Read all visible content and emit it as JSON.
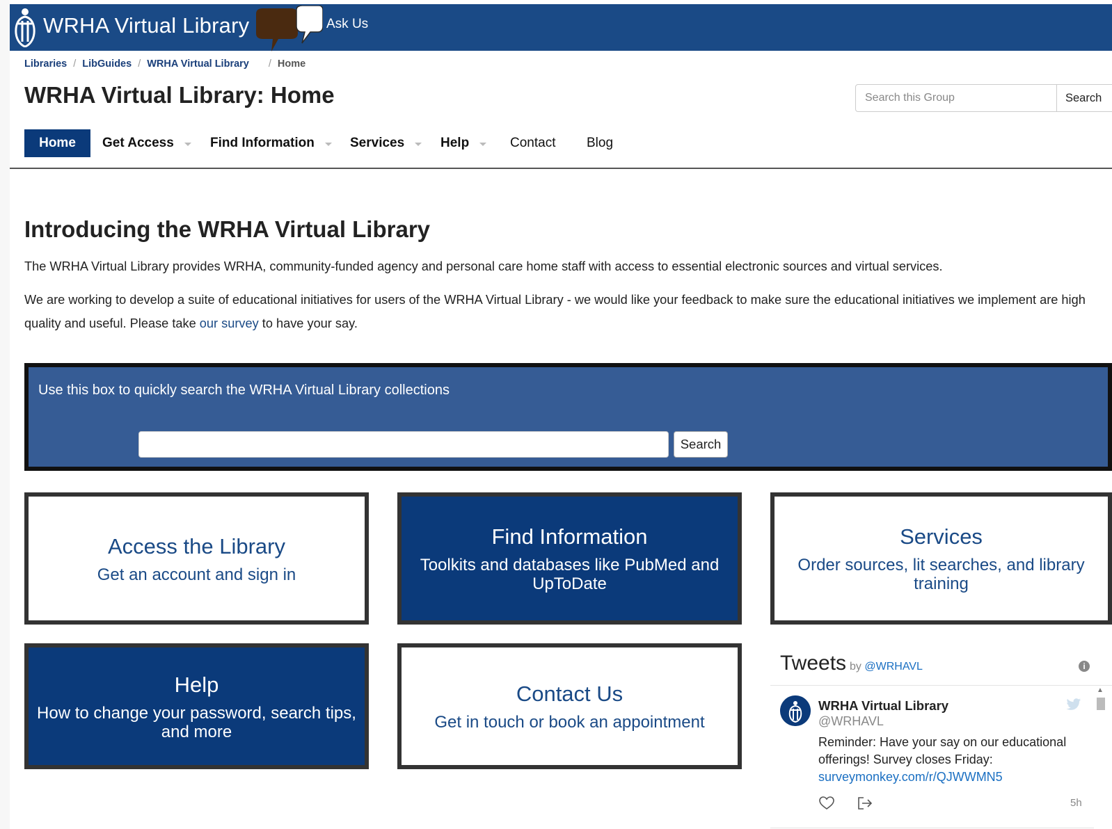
{
  "header": {
    "brand": "WRHA Virtual Library",
    "ask_us": "Ask Us"
  },
  "breadcrumb": {
    "items": [
      "Libraries",
      "LibGuides",
      "WRHA Virtual Library",
      "Home"
    ],
    "separator": "/"
  },
  "page_title": "WRHA Virtual Library: Home",
  "group_search": {
    "placeholder": "Search this Group",
    "button": "Search"
  },
  "nav": {
    "items": [
      {
        "label": "Home",
        "active": true,
        "has_dropdown": false
      },
      {
        "label": "Get Access",
        "active": false,
        "has_dropdown": true
      },
      {
        "label": "Find Information",
        "active": false,
        "has_dropdown": true
      },
      {
        "label": "Services",
        "active": false,
        "has_dropdown": true
      },
      {
        "label": "Help",
        "active": false,
        "has_dropdown": true
      },
      {
        "label": "Contact",
        "active": false,
        "has_dropdown": false
      },
      {
        "label": "Blog",
        "active": false,
        "has_dropdown": false
      }
    ]
  },
  "intro": {
    "heading": "Introducing the WRHA Virtual Library",
    "paragraph1": "The WRHA Virtual Library provides WRHA, community-funded agency and personal care home staff with access to essential electronic sources and virtual services.",
    "paragraph2_before": "We are working to develop a suite of educational initiatives for users of the WRHA Virtual Library - we would like your feedback to make sure the educational initiatives we implement are high quality and useful. Please take",
    "paragraph2_link": "our survey",
    "paragraph2_after": "to have your say."
  },
  "collection_search": {
    "caption": "Use this box to quickly search the WRHA Virtual Library collections",
    "value": "",
    "button": "Search"
  },
  "tiles": {
    "access": {
      "title": "Access the Library",
      "subtitle": "Get an account and sign in"
    },
    "find": {
      "title": "Find Information",
      "subtitle": "Toolkits and databases like PubMed and UpToDate"
    },
    "services": {
      "title": "Services",
      "subtitle": "Order sources, lit searches, and library training"
    },
    "help": {
      "title": "Help",
      "subtitle": "How to change your password, search tips, and more"
    },
    "contact": {
      "title": "Contact Us",
      "subtitle": "Get in touch or book an appointment"
    }
  },
  "tweets": {
    "title": "Tweets",
    "by_prefix": "by",
    "by_handle": "@WRHAVL",
    "tweet": {
      "name": "WRHA Virtual Library",
      "handle": "@WRHAVL",
      "text": "Reminder: Have your say on our educational offerings! Survey closes Friday:",
      "link": "surveymonkey.com/r/QJWWMN5",
      "time": "5h"
    }
  },
  "colors": {
    "banner": "#1a4a86",
    "nav_active": "#0b3a7a",
    "tile_dark": "#0b3a7a",
    "search_box": "#365c95",
    "link": "#1a4a86"
  },
  "icons": {
    "logo": "wrha-person-logo-icon",
    "ask_us": "speech-bubbles-icon",
    "tweets_info": "info-icon",
    "twitter": "twitter-bird-icon",
    "like": "heart-icon",
    "share": "share-icon"
  }
}
